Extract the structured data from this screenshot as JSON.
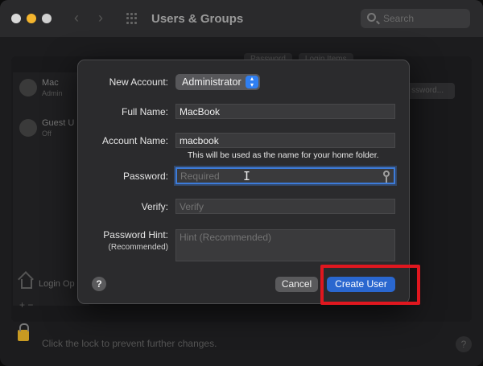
{
  "window": {
    "title": "Users & Groups",
    "search_placeholder": "Search"
  },
  "background": {
    "sidebar": {
      "users": [
        {
          "name": "Mac",
          "role": "Admin"
        },
        {
          "name": "Guest U",
          "role": "Off"
        }
      ],
      "login_options": "Login Op"
    },
    "tabs": [
      "Password",
      "Login Items"
    ],
    "change_password_button": "ssword...",
    "lock_text": "Click the lock to prevent further changes."
  },
  "dialog": {
    "new_account_label": "New Account:",
    "new_account_value": "Administrator",
    "full_name_label": "Full Name:",
    "full_name_value": "MacBook",
    "account_name_label": "Account Name:",
    "account_name_value": "macbook",
    "account_name_hint": "This will be used as the name for your home folder.",
    "password_label": "Password:",
    "password_placeholder": "Required",
    "verify_label": "Verify:",
    "verify_placeholder": "Verify",
    "password_hint_label": "Password Hint:",
    "password_hint_sublabel": "(Recommended)",
    "password_hint_placeholder": "Hint (Recommended)",
    "help_label": "?",
    "cancel_label": "Cancel",
    "create_label": "Create User"
  },
  "colors": {
    "accent": "#2a67cf",
    "highlight": "#e0171f"
  }
}
